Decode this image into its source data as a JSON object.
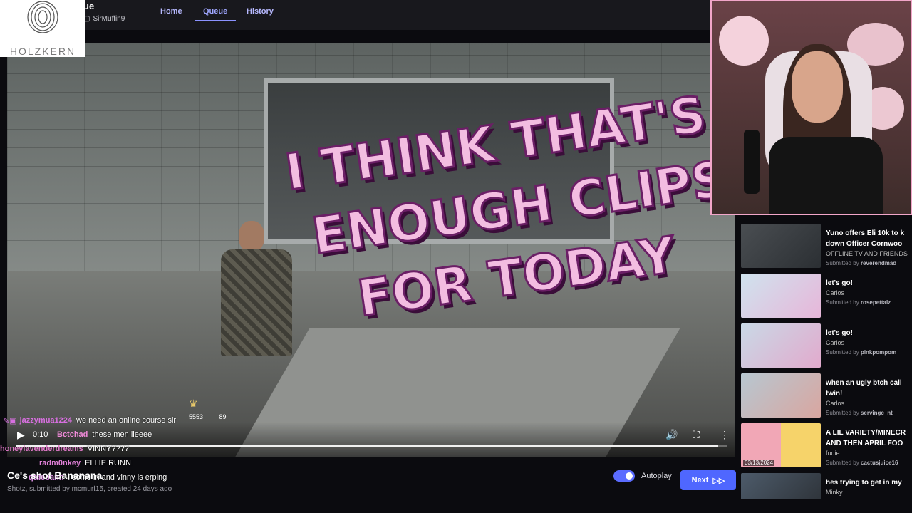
{
  "header": {
    "title_fragment": "ue",
    "channel": "SirMuffin9",
    "tabs": [
      "Home",
      "Queue",
      "History"
    ],
    "active_tab": "Queue"
  },
  "logo": {
    "brand": "HOLZKERN"
  },
  "video": {
    "overlay_text": [
      "I THINK THAT'S",
      "ENOUGH CLIPS",
      "FOR TODAY"
    ],
    "time": "0:10",
    "progress": 0.988,
    "hud_values": [
      "5553",
      "89"
    ]
  },
  "chat": [
    {
      "user": "jazzymua1224",
      "msg": "we need an online course sir",
      "color": "#d86fe0"
    },
    {
      "user": "Bctchad",
      "msg": "these men lieeee",
      "color": "#f08ad8"
    },
    {
      "user": "honeylavenderdreams",
      "msg": "VINNY????",
      "color": "#e078c8"
    },
    {
      "user": "radm0nkey",
      "msg": "ELLIE RUNN",
      "color": "#e080d8"
    },
    {
      "user": "qtdebann",
      "msg": "i come in and vinny is erping",
      "color": "#d88be0"
    }
  ],
  "clip": {
    "title": "Ce's shot Bananana",
    "meta": "Shotz, submitted by mcmurf15, created 24 days ago"
  },
  "player": {
    "autoplay_label": "Autoplay",
    "autoplay_on": true,
    "next_label": "Next"
  },
  "queue": [
    {
      "title": "Yuno offers Eli 10k to k",
      "title2": "down Officer Cornwoo",
      "author": "OFFLINE TV AND FRIENDS",
      "submitter": "reverendmad",
      "thumb_colors": [
        "#4a4e52",
        "#2b2f33"
      ]
    },
    {
      "title": "let's go!",
      "title2": "",
      "author": "Carlos",
      "submitter": "rosepettalz",
      "thumb_colors": [
        "#cfe3ee",
        "#e7b6d9"
      ]
    },
    {
      "title": "let's go!",
      "title2": "",
      "author": "Carlos",
      "submitter": "pinkpompom",
      "thumb_colors": [
        "#c9d9e6",
        "#e2aacd"
      ]
    },
    {
      "title": "when an ugly btch call",
      "title2": "twin!",
      "author": "Carlos",
      "submitter": "servingc_nt",
      "thumb_colors": [
        "#b7c7d1",
        "#d9a6a0"
      ]
    },
    {
      "title": "A LIL VARIETY/MINECR",
      "title2": "AND THEN APRIL FOO",
      "author": "fudie",
      "submitter": "cactusjuice16",
      "date": "03/13/2024",
      "thumb_colors": [
        "#f1a7b6",
        "#f6d36a"
      ]
    },
    {
      "title": "hes trying to get in my",
      "title2": "Minky",
      "author": "",
      "submitter": "",
      "thumb_colors": [
        "#4d5b6a",
        "#2a2e33"
      ]
    }
  ],
  "submitted_by_label": "Submitted by"
}
